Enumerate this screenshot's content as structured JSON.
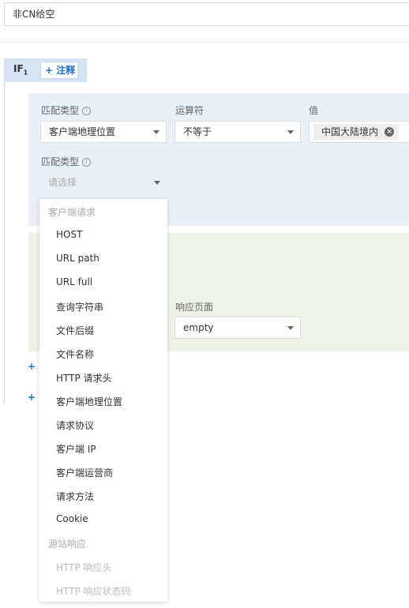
{
  "title_input": {
    "value": "非CN给空"
  },
  "if_block": {
    "label": "IF",
    "index": "1",
    "comment_button": "+ 注释"
  },
  "condition1": {
    "match_type_label": "匹配类型",
    "operator_label": "运算符",
    "value_label": "值",
    "match_type_value": "客户端地理位置",
    "operator_value": "不等于",
    "value_tag": "中国大陆境内"
  },
  "condition2": {
    "match_type_label": "匹配类型",
    "placeholder": "请选择"
  },
  "response": {
    "label": "响应页面",
    "value": "empty"
  },
  "add_links": {
    "first": "+ 扌",
    "second": "+ I"
  },
  "dropdown": {
    "group1": "客户端请求",
    "items": [
      "HOST",
      "URL path",
      "URL full",
      "查询字符串",
      "文件后缀",
      "文件名称",
      "HTTP 请求头",
      "客户端地理位置",
      "请求协议",
      "客户端 IP",
      "客户端运营商",
      "请求方法",
      "Cookie"
    ],
    "group2": "源站响应",
    "disabled_items": [
      "HTTP 响应头",
      "HTTP 响应状态码"
    ]
  },
  "colors": {
    "accent": "#1f6fd1",
    "condition_bg": "#eaf0f7",
    "action_bg": "#eef3e8"
  }
}
